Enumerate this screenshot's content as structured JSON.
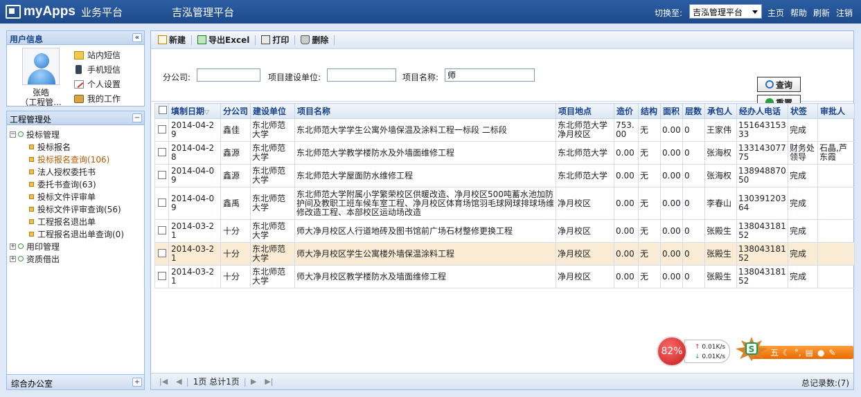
{
  "header": {
    "app_name": "myApps",
    "platform": "业务平台",
    "system_title": "吉泓管理平台",
    "switch_label": "切换至:",
    "switch_value": "吉泓管理平台",
    "links": [
      "主页",
      "帮助",
      "刷新",
      "注销"
    ]
  },
  "user_panel": {
    "title": "用户信息",
    "name": "张皓",
    "role": "（工程管...",
    "links": [
      "站内短信",
      "手机短信",
      "个人设置",
      "我的工作"
    ]
  },
  "tree_panel": {
    "title": "工程管理处",
    "nodes": [
      {
        "label": "投标管理",
        "children": [
          "投标报名",
          "投标报名查询(106)",
          "法人授权委托书",
          "委托书查询(63)",
          "投标文件评审单",
          "投标文件评审查询(56)",
          "工程报名退出单",
          "工程报名退出单查询(0)"
        ]
      },
      {
        "label": "用印管理"
      },
      {
        "label": "资质借出"
      }
    ],
    "footer": "综合办公室"
  },
  "toolbar": {
    "new": "新建",
    "export": "导出Excel",
    "print": "打印",
    "delete": "删除"
  },
  "search": {
    "branch_label": "分公司:",
    "branch_value": "",
    "unit_label": "项目建设单位:",
    "unit_value": "",
    "name_label": "项目名称:",
    "name_value": "师",
    "query_btn": "查询",
    "reset_btn": "重置"
  },
  "table": {
    "columns": [
      "填制日期",
      "分公司",
      "建设单位",
      "项目名称",
      "项目地点",
      "造价",
      "结构",
      "面积",
      "层数",
      "承包人",
      "经办人电话",
      "状签",
      "审批人"
    ],
    "rows": [
      [
        "2014-04-29",
        "鑫佳",
        "东北师范大学",
        "东北师范大学学生公寓外墙保温及涂料工程一标段 二标段",
        "东北师范大学净月校区",
        "753.00",
        "无",
        "0.00",
        "0",
        "王家伟",
        "15164315333",
        "完成",
        ""
      ],
      [
        "2014-04-28",
        "鑫源",
        "东北师范大学",
        "东北师范大学教学楼防水及外墙面维修工程",
        "东北师范大学",
        "0.00",
        "无",
        "0.00",
        "0",
        "张海权",
        "13314307775",
        "财务处领导",
        "石晶,芦东霞"
      ],
      [
        "2014-04-09",
        "鑫源",
        "东北师范大学",
        "东北师范大学屋面防水维修工程",
        "东北师范大学",
        "0.00",
        "无",
        "0.00",
        "0",
        "张海权",
        "13894887050",
        "完成",
        ""
      ],
      [
        "2014-04-09",
        "鑫禹",
        "东北师范大学",
        "东北师范大学附属小学繁荣校区供暖改造、净月校区500吨蓄水池加防护间及教职工班车候车室工程、净月校区体育场馆羽毛球网球排球场维修改造工程、本部校区运动场改造",
        "净月校区",
        "0.00",
        "无",
        "0.00",
        "0",
        "李春山",
        "13039120364",
        "完成",
        ""
      ],
      [
        "2014-03-21",
        "十分",
        "东北师范大学",
        "师大净月校区人行道地砖及图书馆前广场石材整修更换工程",
        "净月校区",
        "0.00",
        "无",
        "0.00",
        "0",
        "张殿生",
        "13804318152",
        "完成",
        ""
      ],
      [
        "2014-03-21",
        "十分",
        "东北师范大学",
        "师大净月校区学生公寓楼外墙保温涂料工程",
        "净月校区",
        "0.00",
        "无",
        "0.00",
        "0",
        "张殿生",
        "13804318152",
        "完成",
        ""
      ],
      [
        "2014-03-21",
        "十分",
        "东北师范大学",
        "师大净月校区教学楼防水及墙面维修工程",
        "净月校区",
        "0.00",
        "无",
        "0.00",
        "0",
        "张殿生",
        "13804318152",
        "完成",
        ""
      ]
    ]
  },
  "pager": {
    "page_text": "1页 总计1页",
    "total_text": "总记录数:(7)"
  },
  "net_monitor": {
    "percent": "82%",
    "up": "0.01K/s",
    "down": "0.01K/s"
  },
  "ime": {
    "mode": "五"
  }
}
